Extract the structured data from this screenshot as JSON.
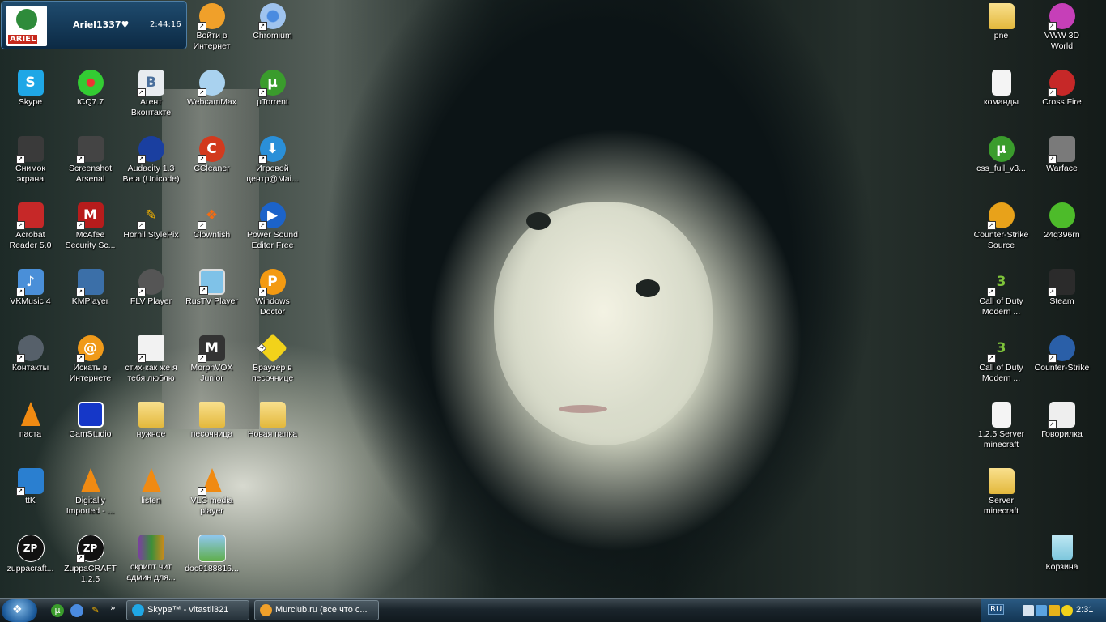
{
  "gadget": {
    "logo_text": "ARIEL",
    "username": "Ariel1337♥",
    "time": "2:44:16"
  },
  "icons": {
    "i_login": "Войти в\nИнтернет",
    "i_chromium": "Chromium",
    "i_skype": "Skype",
    "i_icq": "ICQ7.7",
    "i_vk_agent": "Агент\nВконтакте",
    "i_webcammax": "WebcamMax",
    "i_utorrent": "µTorrent",
    "i_snimok": "Снимок\nэкрана",
    "i_screenshot_arsenal": "Screenshot\nArsenal",
    "i_audacity": "Audacity 1.3\nBeta (Unicode)",
    "i_ccleaner": "CCleaner",
    "i_game_center": "Игровой\nцентр@Mai...",
    "i_acrobat": "Acrobat\nReader 5.0",
    "i_mcafee": "McAfee\nSecurity Sc...",
    "i_hornil": "Hornil StylePix",
    "i_clownfish": "Clownfish",
    "i_power_sound": "Power Sound\nEditor Free",
    "i_vkmusic": "VKMusic 4",
    "i_kmplayer": "KMPlayer",
    "i_flv": "FLV Player",
    "i_rustv": "RusTV Player",
    "i_windoctor": "Windows\nDoctor",
    "i_kontakty": "Контакты",
    "i_iskat": "Искать в\nИнтернете",
    "i_stih": "стих-как же я\nтебя люблю",
    "i_morphvox": "MorphVOX\nJunior",
    "i_brauzer": "Браузер в\nпесочнице",
    "i_pasta": "паста",
    "i_camstudio": "CamStudio",
    "i_nuzhnoe": "нужное",
    "i_pesochnica": "песочница",
    "i_new_folder": "Новая папка",
    "i_ttk": "ttK",
    "i_digitally": "Digitally\nImported - ...",
    "i_listen": "listen",
    "i_vlc": "VLC media\nplayer",
    "i_zuppa1": "zuppacraft...",
    "i_zuppa2": "ZuppaCRAFT\n1.2.5",
    "i_script": "скрипт чит\nадмин для...",
    "i_doc": "doc9188816...",
    "i_pne": "pne",
    "i_vww": "VWW 3D\nWorld",
    "i_komandy": "команды",
    "i_crossfire": "Cross Fire",
    "i_css_full": "css_full_v3...",
    "i_warface": "Warface",
    "i_cs_source": "Counter-Strike\nSource",
    "i_24q": "24q396rn",
    "i_cod1": "Call of Duty\nModern ...",
    "i_steam": "Steam",
    "i_cod2": "Call of Duty\nModern ...",
    "i_cs": "Counter-Strike",
    "i_server125": "1.2.5 Server\nminecraft",
    "i_govorilka": "Говорилка",
    "i_server_mc": "Server\nminecraft",
    "i_korzina": "Корзина"
  },
  "taskbar": {
    "quick_more": "»",
    "task_skype": "Skype™ - vitastii321",
    "task_murclub": "Murclub.ru (все что с...",
    "lang": "RU",
    "clock": "2:31"
  },
  "colors": {
    "taskbar": "#1b252c",
    "tray": "#133553",
    "text": "#ffffff"
  }
}
